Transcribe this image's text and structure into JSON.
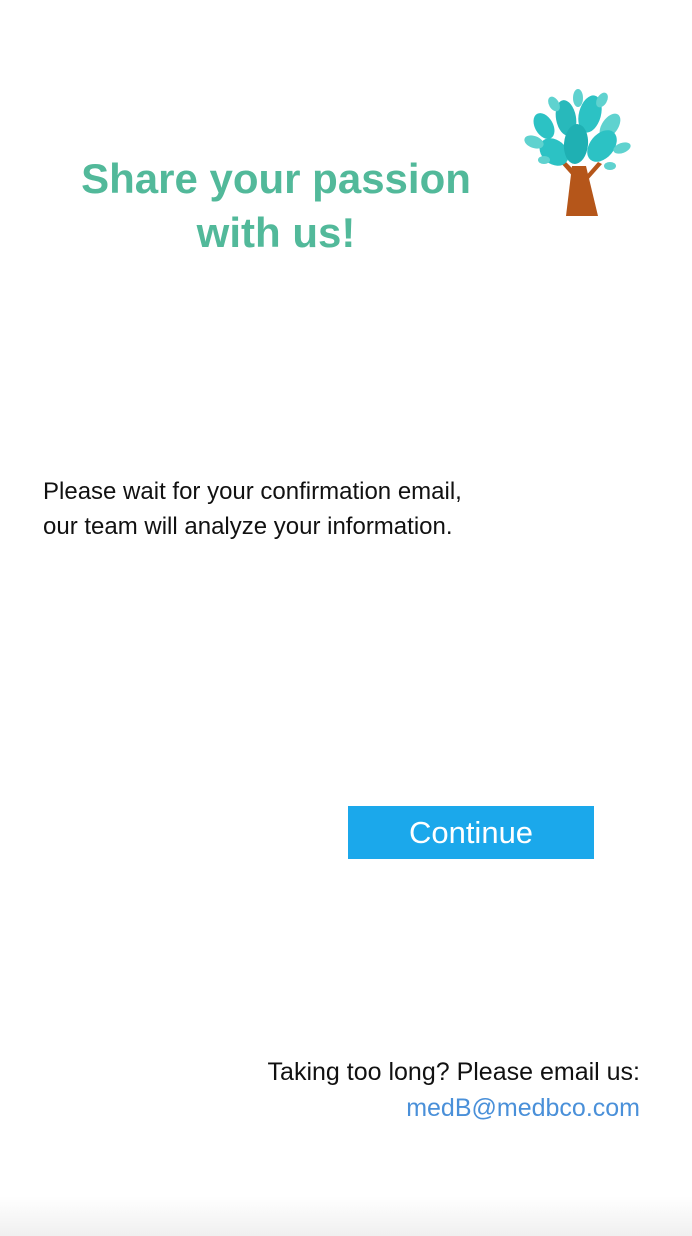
{
  "header": {
    "title_line1": "Share your passion",
    "title_line2": "with us!",
    "logo_icon": "tree-icon"
  },
  "message": {
    "line1": "Please wait for your confirmation email,",
    "line2": "our team will analyze your information."
  },
  "actions": {
    "continue_label": "Continue"
  },
  "footer": {
    "note": "Taking too long? Please email us:",
    "email": "medB@medbco.com"
  },
  "colors": {
    "title": "#52b99a",
    "button": "#1ba8eb",
    "link": "#4a90d9",
    "tree_leaves": "#2cc2c4",
    "tree_trunk": "#b5561a"
  }
}
